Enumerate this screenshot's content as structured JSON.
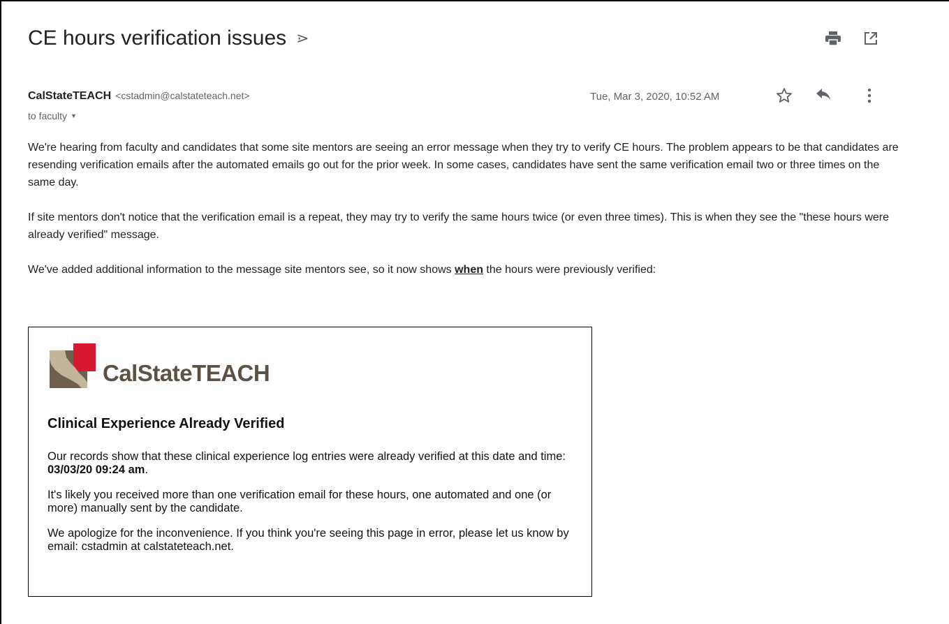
{
  "subject": "CE hours verification issues",
  "icons": {
    "important": "important-marker-icon",
    "print": "print-icon",
    "open_new_window": "open-in-new-window-icon",
    "star": "star-icon",
    "reply": "reply-icon",
    "more": "more-vert-icon",
    "to_dropdown": "caret-down-icon"
  },
  "sender": {
    "name": "CalStateTEACH",
    "email": "<cstadmin@calstateteach.net>"
  },
  "recipients": "to faculty",
  "date": "Tue, Mar 3, 2020, 10:52 AM",
  "body": {
    "p1": "We're hearing from faculty and candidates that some site mentors are seeing an error message when they try to verify CE hours. The problem appears to be that candidates are resending verification emails after the automated emails go out for the prior week. In some cases, candidates have sent the same verification email two or three times on the same day.",
    "p2": "If site mentors don't notice that the verification email is a repeat, they may try to verify the same hours twice (or even three times). This is when they see the \"these hours were already verified\" message.",
    "p3_before": "We've added additional information to the message site mentors see, so it now shows ",
    "p3_emphasis": "when",
    "p3_after": " the hours were previously verified:"
  },
  "embedded": {
    "logo_text": "CalStateTEACH",
    "title": "Clinical Experience Already Verified",
    "p1_before": "Our records show that these clinical experience log entries were already verified at this date and time: ",
    "p1_datetime": "03/03/20 09:24 am",
    "p1_after": ".",
    "p2": "It's likely you received more than one verification email for these hours, one automated and one (or more) manually sent by the candidate.",
    "p3": "We apologize for the inconvenience. If you think you're seeing this page in error, please let us know by email: cstadmin at calstateteach.net."
  },
  "colors": {
    "logo_red": "#d7192f",
    "logo_tan": "#c2b59c",
    "logo_brown": "#6e604c"
  }
}
